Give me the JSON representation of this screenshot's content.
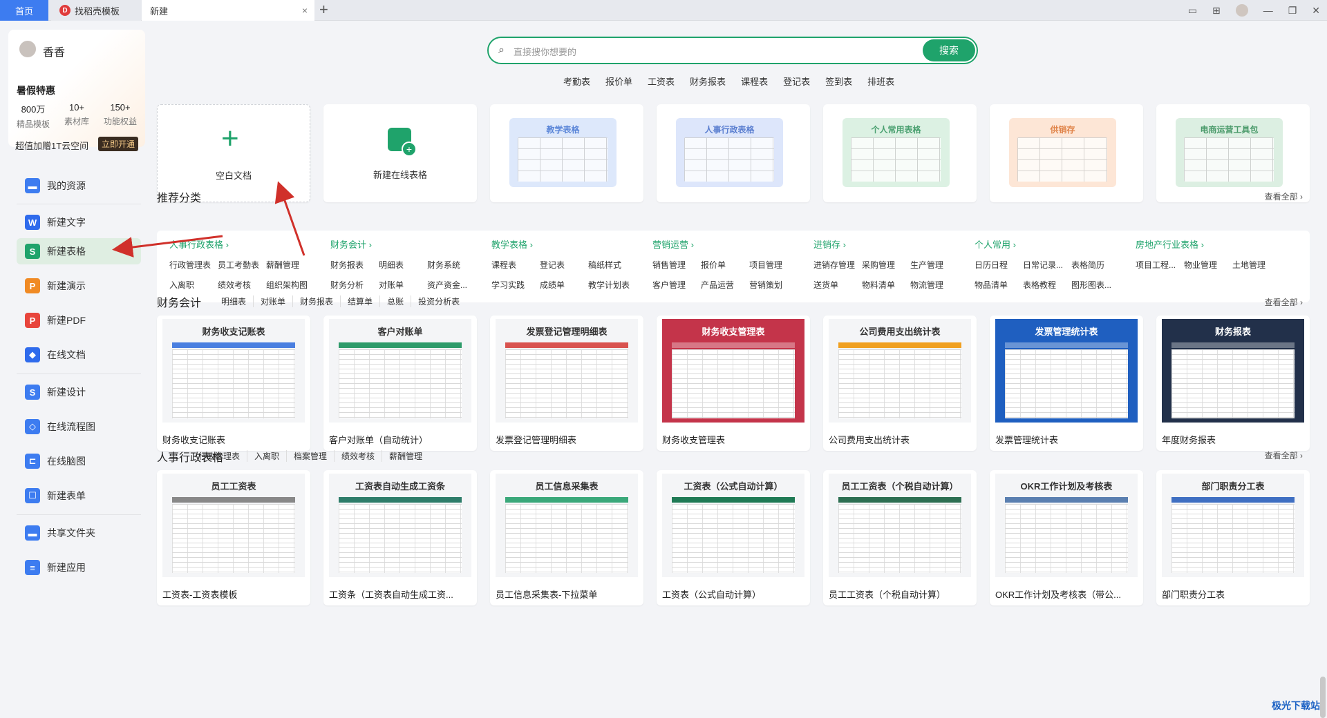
{
  "titlebar": {
    "tabs": [
      {
        "label": "首页"
      },
      {
        "label": "找稻壳模板"
      },
      {
        "label": "新建"
      }
    ],
    "close_glyph": "×",
    "add_glyph": "+"
  },
  "profile": {
    "name": "香香",
    "promo": "暑假特惠",
    "stats": [
      {
        "value": "800万",
        "label": "精品模板"
      },
      {
        "value": "10+",
        "label": "素材库"
      },
      {
        "value": "150+",
        "label": "功能权益"
      }
    ],
    "cloud_text": "超值加赠1T云空间",
    "open_label": "立即开通"
  },
  "nav": [
    {
      "label": "我的资源",
      "icon": "folder-icon",
      "color": "#3d7cf0"
    },
    {
      "label": "新建文字",
      "icon": "writer-icon",
      "color": "#2f6bec"
    },
    {
      "label": "新建表格",
      "icon": "spreadsheet-icon",
      "color": "#1fa36b"
    },
    {
      "label": "新建演示",
      "icon": "presentation-icon",
      "color": "#f08a24"
    },
    {
      "label": "新建PDF",
      "icon": "pdf-icon",
      "color": "#e8453c"
    },
    {
      "label": "在线文档",
      "icon": "online-doc-icon",
      "color": "#2f6bec"
    },
    {
      "label": "新建设计",
      "icon": "design-icon",
      "color": "#3d7cf0"
    },
    {
      "label": "在线流程图",
      "icon": "flowchart-icon",
      "color": "#3d7cf0"
    },
    {
      "label": "在线脑图",
      "icon": "mindmap-icon",
      "color": "#3d7cf0"
    },
    {
      "label": "新建表单",
      "icon": "form-icon",
      "color": "#3d7cf0"
    },
    {
      "label": "共享文件夹",
      "icon": "shared-folder-icon",
      "color": "#3d7cf0"
    },
    {
      "label": "新建应用",
      "icon": "app-icon",
      "color": "#3d7cf0"
    }
  ],
  "search": {
    "placeholder": "直接搜你想要的",
    "button": "搜索",
    "hot": [
      "考勤表",
      "报价单",
      "工资表",
      "财务报表",
      "课程表",
      "登记表",
      "签到表",
      "排班表"
    ]
  },
  "top_cards": [
    {
      "label": "空白文档"
    },
    {
      "label": "新建在线表格"
    },
    {
      "title": "教学表格",
      "color": "#7ea6e8"
    },
    {
      "title": "人事行政表格",
      "color": "#7e9fe0"
    },
    {
      "title": "个人常用表格",
      "color": "#6fc08d"
    },
    {
      "title": "供销存",
      "color": "#f0a36a"
    },
    {
      "title": "电商运营工具包",
      "color": "#6fb689"
    }
  ],
  "recommend": {
    "title": "推荐分类",
    "see_all": "查看全部",
    "columns": [
      {
        "head": "人事行政表格",
        "items": [
          "行政管理表",
          "员工考勤表",
          "薪酬管理",
          "入离职",
          "绩效考核",
          "组织架构图"
        ]
      },
      {
        "head": "财务会计",
        "items": [
          "财务报表",
          "明细表",
          "财务系统",
          "财务分析",
          "对账单",
          "资产资金..."
        ]
      },
      {
        "head": "教学表格",
        "items": [
          "课程表",
          "登记表",
          "稿纸样式",
          "学习实践",
          "成绩单",
          "教学计划表"
        ]
      },
      {
        "head": "营销运营",
        "items": [
          "销售管理",
          "报价单",
          "项目管理",
          "客户管理",
          "产品运营",
          "营销策划"
        ]
      },
      {
        "head": "进销存",
        "items": [
          "进销存管理",
          "采购管理",
          "生产管理",
          "送货单",
          "物料清单",
          "物流管理"
        ]
      },
      {
        "head": "个人常用",
        "items": [
          "日历日程",
          "日常记录...",
          "表格简历",
          "物品清单",
          "表格教程",
          "图形图表..."
        ]
      },
      {
        "head": "房地产行业表格",
        "items": [
          "项目工程...",
          "物业管理",
          "土地管理"
        ]
      }
    ]
  },
  "finance": {
    "title": "财务会计",
    "tabs": [
      "明细表",
      "对账单",
      "财务报表",
      "结算单",
      "总账",
      "投资分析表"
    ],
    "see_all": "查看全部",
    "cards": [
      {
        "thumb": "财务收支记账表",
        "name": "财务收支记账表",
        "accent": "#4a7fe0",
        "dark": false
      },
      {
        "thumb": "客户对账单",
        "name": "客户对账单（自动统计）",
        "accent": "#2e9b6a",
        "dark": false
      },
      {
        "thumb": "发票登记管理明细表",
        "name": "发票登记管理明细表",
        "accent": "#d9534f",
        "dark": false
      },
      {
        "thumb": "财务收支管理表",
        "name": "财务收支管理表",
        "accent": "#c4344a",
        "dark": true
      },
      {
        "thumb": "公司费用支出统计表",
        "name": "公司费用支出统计表",
        "accent": "#f0a020",
        "dark": false
      },
      {
        "thumb": "发票管理统计表",
        "name": "发票管理统计表",
        "accent": "#1f5fc0",
        "dark": true
      },
      {
        "thumb": "财务报表",
        "name": "年度财务报表",
        "accent": "#22304a",
        "dark": true
      }
    ]
  },
  "hr": {
    "title": "人事行政表格",
    "tabs": [
      "行政管理表",
      "入离职",
      "档案管理",
      "绩效考核",
      "薪酬管理"
    ],
    "see_all": "查看全部",
    "cards": [
      {
        "thumb": "员工工资表",
        "name": "工资表-工资表模板",
        "accent": "#888888",
        "dark": false
      },
      {
        "thumb": "工资表自动生成工资条",
        "name": "工资条（工资表自动生成工资...",
        "accent": "#2e7d6a",
        "dark": false
      },
      {
        "thumb": "员工信息采集表",
        "name": "员工信息采集表-下拉菜单",
        "accent": "#3aa87a",
        "dark": false
      },
      {
        "thumb": "工资表（公式自动计算）",
        "name": "工资表（公式自动计算）",
        "accent": "#1f7a55",
        "dark": false
      },
      {
        "thumb": "员工工资表（个税自动计算）",
        "name": "员工工资表（个税自动计算）",
        "accent": "#2d6f52",
        "dark": false
      },
      {
        "thumb": "OKR工作计划及考核表",
        "name": "OKR工作计划及考核表（带公...",
        "accent": "#5a7fb0",
        "dark": false
      },
      {
        "thumb": "部门职责分工表",
        "name": "部门职责分工表",
        "accent": "#3f6fc2",
        "dark": false
      }
    ]
  },
  "watermark": "极光下载站"
}
